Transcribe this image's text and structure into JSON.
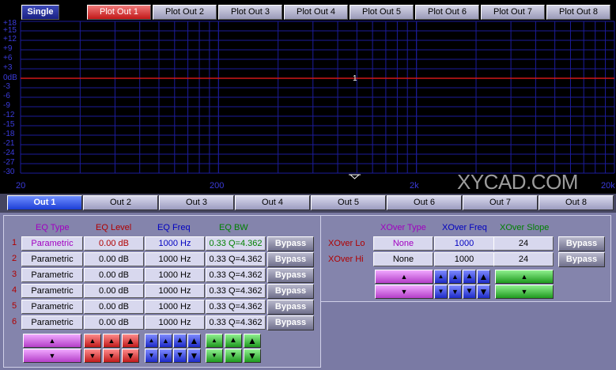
{
  "plot_tabs": [
    "Single",
    "Plot Out 1",
    "Plot Out 2",
    "Plot Out 3",
    "Plot Out 4",
    "Plot Out 5",
    "Plot Out 6",
    "Plot Out 7",
    "Plot Out 8"
  ],
  "plot": {
    "y_labels": [
      "+18",
      "+15",
      "+12",
      "+9",
      "+6",
      "+3",
      "0dB",
      "-3",
      "-6",
      "-9",
      "-12",
      "-15",
      "-18",
      "-21",
      "-24",
      "-27",
      "-30"
    ],
    "x_labels": [
      "20",
      "200",
      "2k",
      "20k"
    ],
    "curve_label": "1",
    "curve_level_db": 0,
    "watermark": "XYCAD.COM",
    "colors": {
      "grid": "#1c1c9a",
      "curve": "#d01818",
      "labels": "#3b3bdb"
    }
  },
  "out_tabs": [
    "Out 1",
    "Out 2",
    "Out 3",
    "Out 4",
    "Out 5",
    "Out 6",
    "Out 7",
    "Out 8"
  ],
  "eq": {
    "headers": {
      "type": "EQ Type",
      "level": "EQ Level",
      "freq": "EQ Freq",
      "bw": "EQ BW"
    },
    "bypass_label": "Bypass",
    "rows": [
      {
        "n": "1",
        "type": "Parametric",
        "level": "0.00 dB",
        "freq": "1000 Hz",
        "bw": "0.33 Q=4.362"
      },
      {
        "n": "2",
        "type": "Parametric",
        "level": "0.00 dB",
        "freq": "1000 Hz",
        "bw": "0.33 Q=4.362"
      },
      {
        "n": "3",
        "type": "Parametric",
        "level": "0.00 dB",
        "freq": "1000 Hz",
        "bw": "0.33 Q=4.362"
      },
      {
        "n": "4",
        "type": "Parametric",
        "level": "0.00 dB",
        "freq": "1000 Hz",
        "bw": "0.33 Q=4.362"
      },
      {
        "n": "5",
        "type": "Parametric",
        "level": "0.00 dB",
        "freq": "1000 Hz",
        "bw": "0.33 Q=4.362"
      },
      {
        "n": "6",
        "type": "Parametric",
        "level": "0.00 dB",
        "freq": "1000 Hz",
        "bw": "0.33 Q=4.362"
      }
    ]
  },
  "xover": {
    "headers": {
      "type": "XOver Type",
      "freq": "XOver Freq",
      "slope": "XOver Slope"
    },
    "bypass_label": "Bypass",
    "rows": [
      {
        "label": "XOver Lo",
        "type": "None",
        "freq": "1000",
        "slope": "24"
      },
      {
        "label": "XOver Hi",
        "type": "None",
        "freq": "1000",
        "slope": "24"
      }
    ]
  },
  "glyphs": {
    "up": "▲",
    "down": "▼"
  }
}
